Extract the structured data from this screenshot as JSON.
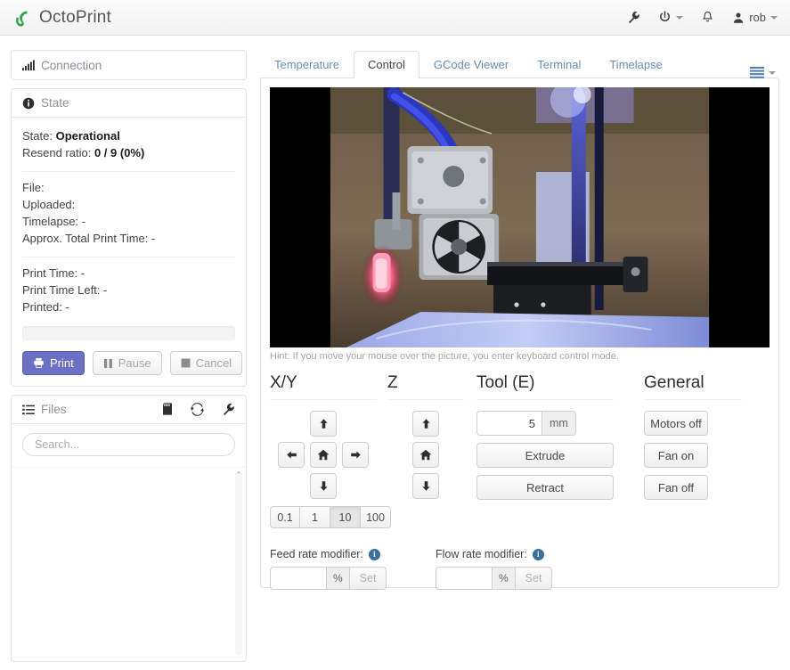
{
  "navbar": {
    "brand": "OctoPrint",
    "logo_icon": "octopus-logo-icon",
    "wrench_icon": "wrench-icon",
    "power_icon": "power-icon",
    "bell_icon": "bell-icon",
    "user_icon": "user-icon",
    "username": "rob"
  },
  "sidebar": {
    "connection": {
      "title": "Connection",
      "icon": "signal-bars-icon"
    },
    "state": {
      "title": "State",
      "icon": "info-circle-icon",
      "rows": [
        {
          "label": "State:",
          "value": "Operational",
          "strong": true
        },
        {
          "label": "Resend ratio:",
          "value": "0 / 9 (0%)",
          "strong": true
        }
      ],
      "file_rows": [
        {
          "label": "File:",
          "value": ""
        },
        {
          "label": "Uploaded:",
          "value": ""
        },
        {
          "label": "Timelapse:",
          "value": "-"
        },
        {
          "label": "Approx. Total Print Time:",
          "value": "-"
        }
      ],
      "time_rows": [
        {
          "label": "Print Time:",
          "value": "-"
        },
        {
          "label": "Print Time Left:",
          "value": "-"
        },
        {
          "label": "Printed:",
          "value": "-"
        }
      ],
      "buttons": [
        {
          "label": "Print",
          "icon": "printer-icon",
          "style": "primary",
          "disabled": false
        },
        {
          "label": "Pause",
          "icon": "pause-icon",
          "style": "default",
          "disabled": true
        },
        {
          "label": "Cancel",
          "icon": "stop-icon",
          "style": "default",
          "disabled": true
        }
      ]
    },
    "files": {
      "title": "Files",
      "icon": "list-icon",
      "actions": [
        {
          "name": "sd-card-icon"
        },
        {
          "name": "refresh-icon"
        },
        {
          "name": "wrench-icon"
        }
      ],
      "search_placeholder": "Search..."
    }
  },
  "main": {
    "tabs": [
      {
        "label": "Temperature",
        "active": false
      },
      {
        "label": "Control",
        "active": true
      },
      {
        "label": "GCode Viewer",
        "active": false
      },
      {
        "label": "Terminal",
        "active": false
      },
      {
        "label": "Timelapse",
        "active": false
      }
    ],
    "tabs_menu_icon": "list-menu-icon",
    "webcam": {
      "alt": "webcam-stream"
    },
    "hint": "Hint: If you move your mouse over the picture, you enter keyboard control mode.",
    "columns": {
      "xy": {
        "title": "X/Y",
        "buttons": {
          "up": "arrow-up-icon",
          "left": "arrow-left-icon",
          "home": "home-icon",
          "right": "arrow-right-icon",
          "down": "arrow-down-icon"
        },
        "steps": [
          {
            "label": "0.1",
            "active": false
          },
          {
            "label": "1",
            "active": false
          },
          {
            "label": "10",
            "active": true
          },
          {
            "label": "100",
            "active": false
          }
        ]
      },
      "z": {
        "title": "Z",
        "buttons": {
          "up": "arrow-up-icon",
          "home": "home-icon",
          "down": "arrow-down-icon"
        }
      },
      "tool": {
        "title": "Tool (E)",
        "amount_value": "5",
        "amount_unit": "mm",
        "extrude_label": "Extrude",
        "retract_label": "Retract"
      },
      "general": {
        "title": "General",
        "motors_off_label": "Motors off",
        "fan_on_label": "Fan on",
        "fan_off_label": "Fan off"
      }
    },
    "feed_rate": {
      "label": "Feed rate modifier:",
      "info_icon": "info-icon",
      "value": "",
      "unit": "%",
      "set_label": "Set"
    },
    "flow_rate": {
      "label": "Flow rate modifier:",
      "info_icon": "info-icon",
      "value": "",
      "unit": "%",
      "set_label": "Set"
    }
  },
  "colors": {
    "primary": "#6b70c4",
    "link": "#6a8fb5",
    "brand_green": "#2ea44f",
    "info": "#3a6f9a"
  }
}
